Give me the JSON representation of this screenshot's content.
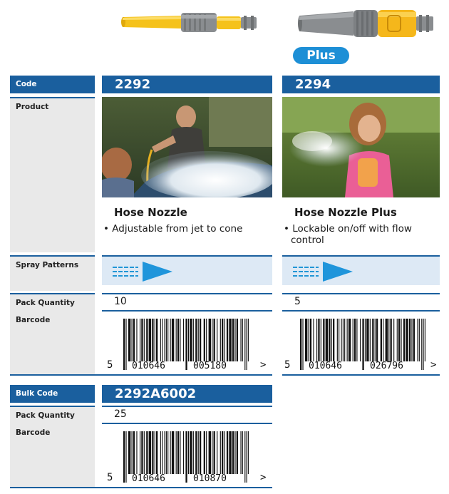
{
  "products": [
    {
      "code": "2292",
      "title": "Hose Nozzle",
      "feature": "Adjustable from jet to cone",
      "pack_quantity": "10",
      "barcode": {
        "first": "5",
        "left": "010646",
        "right": "005180",
        "end": ">"
      }
    },
    {
      "code": "2294",
      "badge": "Plus",
      "title": "Hose Nozzle Plus",
      "feature": "Lockable on/off with flow control",
      "pack_quantity": "5",
      "barcode": {
        "first": "5",
        "left": "010646",
        "right": "026796",
        "end": ">"
      }
    }
  ],
  "labels": {
    "code": "Code",
    "product": "Product",
    "spray_patterns": "Spray Patterns",
    "pack_quantity": "Pack Quantity",
    "barcode": "Barcode",
    "bulk_code": "Bulk Code"
  },
  "bulk": {
    "code": "2292A6002",
    "pack_quantity": "25",
    "barcode": {
      "first": "5",
      "left": "010646",
      "right": "010870",
      "end": ">"
    }
  },
  "colors": {
    "brand_blue": "#1a5f9e",
    "badge_blue": "#1d8fd6",
    "nozzle_yellow": "#f5c21b",
    "nozzle_grey": "#8a8d90",
    "label_bg": "#e9e9e9",
    "spray_bg": "#dde9f5"
  },
  "icons": {
    "nozzle_2292": "hose-nozzle-yellow-grey",
    "nozzle_2294": "hose-nozzle-plus-grey-yellow",
    "spray_pattern": "jet-and-cone-spray-icon",
    "photo_2292": "man-washing-car-photo",
    "photo_2294": "girl-playing-with-hose-photo"
  }
}
